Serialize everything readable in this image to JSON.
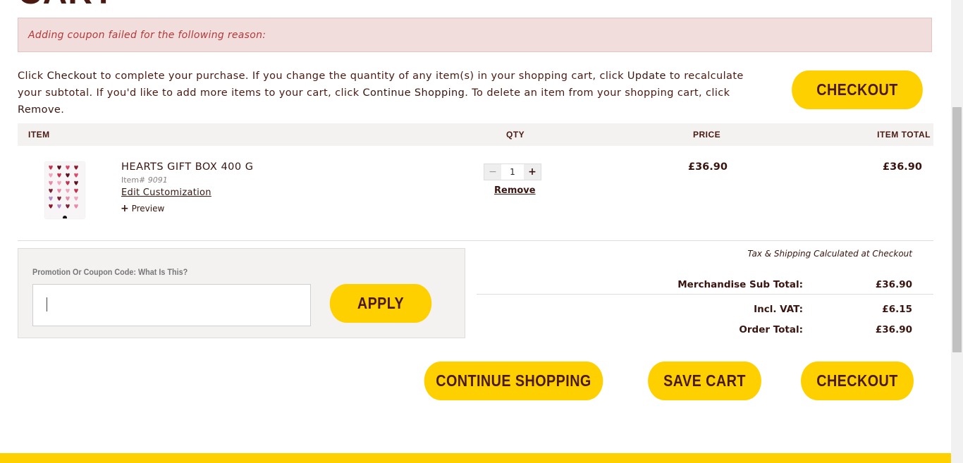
{
  "page": {
    "title": "CART"
  },
  "error": {
    "message": "Adding coupon failed for the following reason:"
  },
  "instructions": {
    "p1": "Click ",
    "k1": "Checkout",
    "p2": " to complete your purchase. If you change the quantity of any item(s) in your shopping cart, click ",
    "k2": "Update",
    "p3": " to recalculate your subtotal. If you'd like to add more items to your cart, click ",
    "k3": "Continue Shopping",
    "p4": ". To delete an item from your shopping cart, click ",
    "k4": "Remove",
    "p5": "."
  },
  "buttons": {
    "checkout_top": "CHECKOUT",
    "apply": "APPLY",
    "continue_shopping": "CONTINUE SHOPPING",
    "save_cart": "SAVE CART",
    "checkout_bottom": "CHECKOUT"
  },
  "table": {
    "headers": {
      "item": "ITEM",
      "qty": "QTY",
      "price": "PRICE",
      "total": "ITEM TOTAL"
    }
  },
  "cart_item": {
    "name": "HEARTS GIFT BOX 400 G",
    "item_label": "Item#",
    "item_number": "9091",
    "edit": "Edit Customization",
    "preview_icon": "plus-icon",
    "preview": "Preview",
    "qty": "1",
    "qty_minus": "−",
    "qty_plus": "+",
    "remove": "Remove",
    "price": "£36.90",
    "total": "£36.90"
  },
  "promo": {
    "label": "Promotion Or Coupon Code: What Is This?",
    "value": ""
  },
  "summary": {
    "tax_note": "Tax & Shipping Calculated at Checkout",
    "subtotal_label": "Merchandise Sub Total:",
    "subtotal_value": "£36.90",
    "vat_label": "Incl. VAT:",
    "vat_value": "£6.15",
    "order_total_label": "Order Total:",
    "order_total_value": "£36.90"
  },
  "colors": {
    "accent": "#ffd000",
    "text": "#4a1a12",
    "error_bg": "#f2dddd",
    "error_text": "#b03a3a"
  }
}
